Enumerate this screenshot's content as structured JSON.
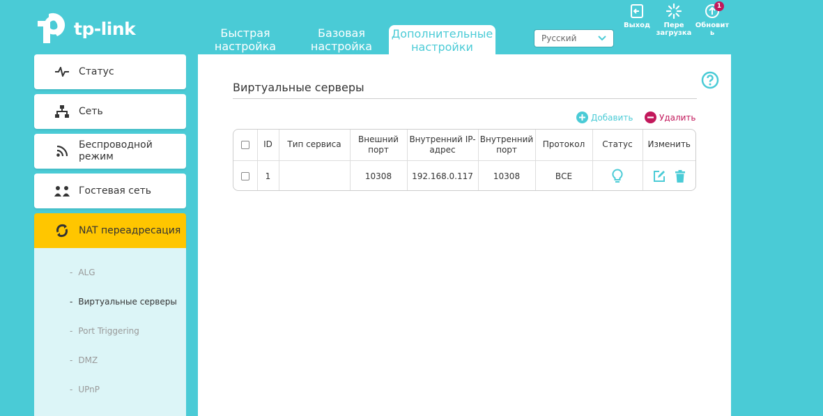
{
  "header": {
    "logo_text": "tp-link",
    "tabs": [
      {
        "line1": "Быстрая",
        "line2": "настройка"
      },
      {
        "line1": "Базовая",
        "line2": "настройка"
      },
      {
        "line1": "Дополнительные",
        "line2": "настройки"
      }
    ],
    "language": "Русский",
    "actions": {
      "logout": "Выход",
      "reboot_line1": "Пере",
      "reboot_line2": "загрузка",
      "update_line1": "Обновит",
      "update_line2": "ь",
      "update_badge": "1"
    }
  },
  "sidebar": {
    "items": [
      {
        "label": "Статус",
        "icon": "pulse-icon"
      },
      {
        "label": "Сеть",
        "icon": "network-icon"
      },
      {
        "label_line1": "Беспроводной",
        "label_line2": "режим",
        "icon": "wireless-icon"
      },
      {
        "label": "Гостевая сеть",
        "icon": "guest-network-icon"
      },
      {
        "label": "NAT переадресация",
        "icon": "nat-icon"
      }
    ],
    "submenu": [
      {
        "label": "ALG"
      },
      {
        "label": "Виртуальные серверы"
      },
      {
        "label": "Port Triggering"
      },
      {
        "label": "DMZ"
      },
      {
        "label": "UPnP"
      }
    ]
  },
  "main": {
    "title": "Виртуальные серверы",
    "add_label": "Добавить",
    "delete_label": "Удалить",
    "table": {
      "columns": [
        {
          "line1": "ID",
          "line2": ""
        },
        {
          "line1": "Тип сервиса",
          "line2": ""
        },
        {
          "line1": "Внешний",
          "line2": "порт"
        },
        {
          "line1": "Внутренний IP-",
          "line2": "адрес"
        },
        {
          "line1": "Внутренний",
          "line2": "порт"
        },
        {
          "line1": "Протокол",
          "line2": ""
        },
        {
          "line1": "Статус",
          "line2": ""
        },
        {
          "line1": "Изменить",
          "line2": ""
        }
      ],
      "rows": [
        {
          "id": "1",
          "service": "",
          "ext_port": "10308",
          "int_ip": "192.168.0.117",
          "int_port": "10308",
          "protocol": "ВСЕ"
        }
      ]
    }
  },
  "colors": {
    "brand_teal": "#4acbd6",
    "active_yellow": "#ffc600",
    "delete_red": "#c2185b",
    "submenu_bg": "#dcf5f7"
  }
}
